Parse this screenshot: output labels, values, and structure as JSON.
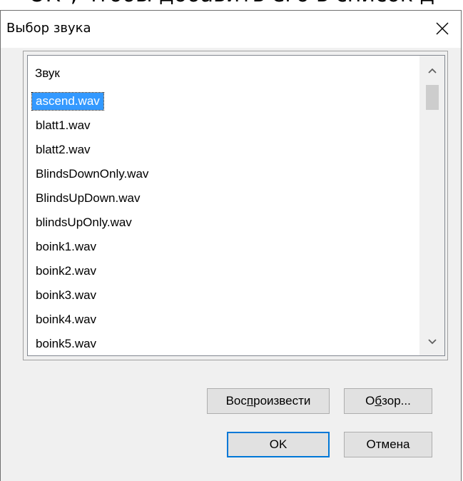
{
  "background": {
    "text": "ОК\", чтобы добавить его в список д"
  },
  "dialog": {
    "title": "Выбор звука",
    "close_icon": "close-icon"
  },
  "list": {
    "header": "Звук",
    "selected_index": 0,
    "items": [
      "ascend.wav",
      "blatt1.wav",
      "blatt2.wav",
      "BlindsDownOnly.wav",
      "BlindsUpDown.wav",
      "blindsUpOnly.wav",
      "boink1.wav",
      "boink2.wav",
      "boink3.wav",
      "boink4.wav",
      "boink5.wav"
    ],
    "scroll_up_icon": "chevron-up-icon",
    "scroll_down_icon": "chevron-down-icon"
  },
  "buttons": {
    "play": {
      "before": "Вос",
      "mnemonic": "п",
      "after": "роизвести"
    },
    "browse": {
      "before": "О",
      "mnemonic": "б",
      "after": "зор..."
    },
    "ok": "OK",
    "cancel": "Отмена"
  },
  "colors": {
    "selection": "#3399ff",
    "default_button_border": "#0078d7",
    "dialog_background": "#f0f0f0"
  }
}
